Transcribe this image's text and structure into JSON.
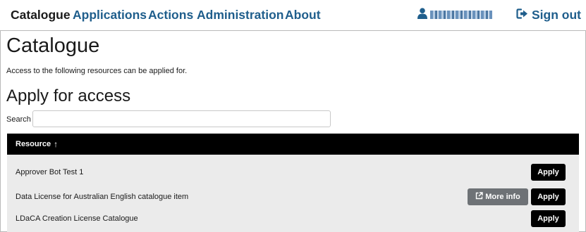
{
  "nav": {
    "items": [
      "Catalogue",
      "Applications",
      "Actions",
      "Administration",
      "About"
    ],
    "active": "Catalogue",
    "signout_label": "Sign out"
  },
  "user": {
    "icon": "user-icon"
  },
  "page": {
    "title": "Catalogue",
    "intro": "Access to the following resources can be applied for.",
    "section_title": "Apply for access",
    "search_label": "Search",
    "search_value": ""
  },
  "table": {
    "header": "Resource",
    "sort_indicator": "↑",
    "rows": [
      {
        "name": "Approver Bot Test 1",
        "apply_label": "Apply"
      },
      {
        "name": "Data License for Australian English catalogue item",
        "more_info_label": "More info",
        "apply_label": "Apply"
      },
      {
        "name": "LDaCA Creation License Catalogue",
        "apply_label": "Apply"
      }
    ]
  },
  "colors": {
    "link": "#1f5e8c",
    "header_bg": "#000000",
    "row_bg": "#ebebeb",
    "more_info_bg": "#6e7276"
  }
}
